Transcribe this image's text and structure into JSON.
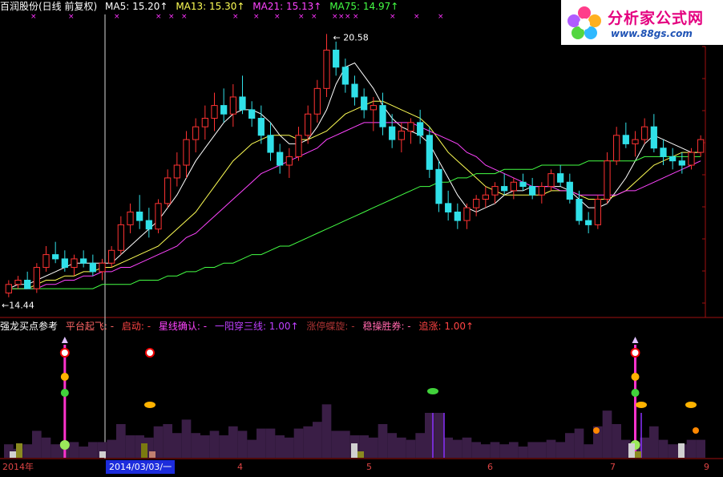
{
  "header": {
    "stock": "百润股份(日线 前复权)",
    "ma_items": [
      {
        "label": "MA5: 15.20↑",
        "color": "#ffffff"
      },
      {
        "label": "MA13: 15.30↑",
        "color": "#ffff55"
      },
      {
        "label": "MA21: 15.13↑",
        "color": "#ff44ff"
      },
      {
        "label": "MA75: 14.97↑",
        "color": "#44ff44"
      }
    ]
  },
  "logo": {
    "title": "分析家公式网",
    "url": "www.88gs.com"
  },
  "main_chart": {
    "type": "candlestick",
    "high_label": "20.58",
    "low_label": "14.44",
    "ylim": [
      14.0,
      21.0
    ],
    "up_color": "#ff3232",
    "down_color": "#30e0e8",
    "candles": [
      [
        14.5,
        14.8,
        14.4,
        14.7
      ],
      [
        14.7,
        14.9,
        14.6,
        14.8
      ],
      [
        14.8,
        15.0,
        14.6,
        14.6
      ],
      [
        14.6,
        15.2,
        14.5,
        15.1
      ],
      [
        15.1,
        15.6,
        15.0,
        15.4
      ],
      [
        15.4,
        15.7,
        15.2,
        15.3
      ],
      [
        15.3,
        15.5,
        15.0,
        15.1
      ],
      [
        15.1,
        15.4,
        14.9,
        15.3
      ],
      [
        15.3,
        15.5,
        15.1,
        15.2
      ],
      [
        15.2,
        15.4,
        14.9,
        15.0
      ],
      [
        15.0,
        15.3,
        14.8,
        15.2
      ],
      [
        15.2,
        15.6,
        15.1,
        15.5
      ],
      [
        15.5,
        16.3,
        15.4,
        16.1
      ],
      [
        16.1,
        16.6,
        15.9,
        16.4
      ],
      [
        16.4,
        16.8,
        16.0,
        16.2
      ],
      [
        16.2,
        16.5,
        15.8,
        16.0
      ],
      [
        16.0,
        16.7,
        15.9,
        16.6
      ],
      [
        16.6,
        17.4,
        16.5,
        17.2
      ],
      [
        17.2,
        17.8,
        17.0,
        17.5
      ],
      [
        17.5,
        18.3,
        17.2,
        18.1
      ],
      [
        18.1,
        18.6,
        17.8,
        18.4
      ],
      [
        18.4,
        18.9,
        18.1,
        18.6
      ],
      [
        18.6,
        19.2,
        18.3,
        18.9
      ],
      [
        18.9,
        19.3,
        18.5,
        18.7
      ],
      [
        18.7,
        19.4,
        18.4,
        19.1
      ],
      [
        19.1,
        19.6,
        18.7,
        18.8
      ],
      [
        18.8,
        19.0,
        18.4,
        18.6
      ],
      [
        18.6,
        18.9,
        18.0,
        18.2
      ],
      [
        18.2,
        18.5,
        17.6,
        17.8
      ],
      [
        17.8,
        18.0,
        17.3,
        17.5
      ],
      [
        17.5,
        17.9,
        17.2,
        17.7
      ],
      [
        17.7,
        18.4,
        17.6,
        18.2
      ],
      [
        18.2,
        18.9,
        18.0,
        18.7
      ],
      [
        18.7,
        19.5,
        18.5,
        19.3
      ],
      [
        19.3,
        20.58,
        19.1,
        20.2
      ],
      [
        20.2,
        20.4,
        19.6,
        19.8
      ],
      [
        19.8,
        20.0,
        19.2,
        19.4
      ],
      [
        19.4,
        19.6,
        18.9,
        19.1
      ],
      [
        19.1,
        19.3,
        18.6,
        18.8
      ],
      [
        18.8,
        19.1,
        18.3,
        18.9
      ],
      [
        18.9,
        19.2,
        18.2,
        18.4
      ],
      [
        18.4,
        18.7,
        17.9,
        18.1
      ],
      [
        18.1,
        18.5,
        17.8,
        18.3
      ],
      [
        18.3,
        18.6,
        18.0,
        18.5
      ],
      [
        18.5,
        18.8,
        18.0,
        18.2
      ],
      [
        18.2,
        18.4,
        17.2,
        17.4
      ],
      [
        17.4,
        17.6,
        16.4,
        16.6
      ],
      [
        16.6,
        16.9,
        16.2,
        16.4
      ],
      [
        16.4,
        16.6,
        16.0,
        16.2
      ],
      [
        16.2,
        16.6,
        16.0,
        16.5
      ],
      [
        16.5,
        16.8,
        16.3,
        16.7
      ],
      [
        16.7,
        17.0,
        16.5,
        16.8
      ],
      [
        16.8,
        17.1,
        16.6,
        17.0
      ],
      [
        17.0,
        17.3,
        16.8,
        16.9
      ],
      [
        16.9,
        17.2,
        16.7,
        17.1
      ],
      [
        17.1,
        17.3,
        16.9,
        17.0
      ],
      [
        17.0,
        17.2,
        16.7,
        16.8
      ],
      [
        16.8,
        17.1,
        16.6,
        17.0
      ],
      [
        17.0,
        17.4,
        16.9,
        17.3
      ],
      [
        17.3,
        17.5,
        17.0,
        17.1
      ],
      [
        17.1,
        17.3,
        16.6,
        16.7
      ],
      [
        16.7,
        16.9,
        16.1,
        16.2
      ],
      [
        16.2,
        16.4,
        15.9,
        16.1
      ],
      [
        16.1,
        16.8,
        16.0,
        16.7
      ],
      [
        16.7,
        17.8,
        16.6,
        17.6
      ],
      [
        17.6,
        18.4,
        17.5,
        18.2
      ],
      [
        18.2,
        18.5,
        17.9,
        18.0
      ],
      [
        18.0,
        18.3,
        17.7,
        18.1
      ],
      [
        18.1,
        18.6,
        18.0,
        18.4
      ],
      [
        18.4,
        18.7,
        17.8,
        17.9
      ],
      [
        17.9,
        18.1,
        17.5,
        17.7
      ],
      [
        17.7,
        17.9,
        17.4,
        17.6
      ],
      [
        17.6,
        17.8,
        17.3,
        17.5
      ],
      [
        17.5,
        17.9,
        17.4,
        17.8
      ],
      [
        17.8,
        18.2,
        17.7,
        18.1
      ]
    ],
    "ma_lines": [
      {
        "name": "MA5",
        "color": "#ffffff",
        "values": [
          14.6,
          14.7,
          14.7,
          14.8,
          14.9,
          15.0,
          15.1,
          15.2,
          15.2,
          15.2,
          15.2,
          15.2,
          15.4,
          15.6,
          15.8,
          16.0,
          16.2,
          16.5,
          16.8,
          17.2,
          17.6,
          17.9,
          18.2,
          18.5,
          18.7,
          18.8,
          18.8,
          18.7,
          18.5,
          18.2,
          18.0,
          18.0,
          18.1,
          18.4,
          18.8,
          19.4,
          19.8,
          19.9,
          19.6,
          19.3,
          18.9,
          18.6,
          18.4,
          18.3,
          18.2,
          18.0,
          17.6,
          17.2,
          16.8,
          16.5,
          16.4,
          16.5,
          16.6,
          16.8,
          16.9,
          16.9,
          17.0,
          17.0,
          17.0,
          17.0,
          16.9,
          16.7,
          16.5,
          16.5,
          16.6,
          16.9,
          17.2,
          17.6,
          18.0,
          18.2,
          18.1,
          18.0,
          17.9,
          17.8,
          17.8
        ]
      },
      {
        "name": "MA13",
        "color": "#ffff55",
        "values": [
          14.6,
          14.6,
          14.6,
          14.7,
          14.8,
          14.8,
          14.9,
          14.9,
          15.0,
          15.0,
          15.1,
          15.1,
          15.2,
          15.3,
          15.4,
          15.5,
          15.6,
          15.8,
          16.0,
          16.2,
          16.4,
          16.7,
          17.0,
          17.3,
          17.6,
          17.8,
          18.0,
          18.1,
          18.2,
          18.2,
          18.2,
          18.1,
          18.1,
          18.2,
          18.3,
          18.5,
          18.7,
          18.8,
          18.9,
          19.0,
          19.0,
          18.9,
          18.8,
          18.7,
          18.6,
          18.4,
          18.1,
          17.8,
          17.6,
          17.4,
          17.2,
          17.0,
          16.9,
          16.8,
          16.8,
          16.8,
          16.8,
          16.8,
          16.9,
          16.9,
          16.9,
          16.8,
          16.7,
          16.7,
          16.7,
          16.8,
          16.9,
          17.1,
          17.3,
          17.5,
          17.6,
          17.7,
          17.8,
          17.8,
          17.8
        ]
      },
      {
        "name": "MA21",
        "color": "#ff44ff",
        "values": [
          14.6,
          14.6,
          14.6,
          14.6,
          14.7,
          14.7,
          14.8,
          14.8,
          14.9,
          14.9,
          15.0,
          15.0,
          15.1,
          15.1,
          15.2,
          15.3,
          15.4,
          15.5,
          15.6,
          15.8,
          15.9,
          16.1,
          16.3,
          16.5,
          16.7,
          16.9,
          17.1,
          17.3,
          17.4,
          17.5,
          17.6,
          17.7,
          17.8,
          17.9,
          18.1,
          18.2,
          18.3,
          18.4,
          18.5,
          18.5,
          18.5,
          18.5,
          18.5,
          18.5,
          18.4,
          18.3,
          18.2,
          18.1,
          18.0,
          17.8,
          17.7,
          17.5,
          17.4,
          17.3,
          17.2,
          17.1,
          17.0,
          17.0,
          17.0,
          16.9,
          16.9,
          16.8,
          16.8,
          16.8,
          16.8,
          16.8,
          16.9,
          16.9,
          17.0,
          17.1,
          17.2,
          17.3,
          17.4,
          17.5,
          17.6
        ]
      },
      {
        "name": "MA75",
        "color": "#44ff44",
        "values": [
          14.6,
          14.6,
          14.6,
          14.6,
          14.6,
          14.6,
          14.6,
          14.6,
          14.6,
          14.6,
          14.7,
          14.7,
          14.7,
          14.7,
          14.8,
          14.8,
          14.8,
          14.9,
          14.9,
          15.0,
          15.0,
          15.1,
          15.1,
          15.2,
          15.2,
          15.3,
          15.4,
          15.4,
          15.5,
          15.6,
          15.6,
          15.7,
          15.8,
          15.9,
          16.0,
          16.1,
          16.2,
          16.3,
          16.4,
          16.5,
          16.6,
          16.7,
          16.8,
          16.9,
          17.0,
          17.0,
          17.1,
          17.1,
          17.2,
          17.2,
          17.3,
          17.3,
          17.3,
          17.4,
          17.4,
          17.4,
          17.4,
          17.5,
          17.5,
          17.5,
          17.5,
          17.5,
          17.6,
          17.6,
          17.6,
          17.6,
          17.6,
          17.6,
          17.7,
          17.7,
          17.7,
          17.7,
          17.7,
          17.7,
          17.7
        ]
      }
    ]
  },
  "indicator": {
    "items": [
      {
        "label": "强龙买点参考",
        "color": "#ffffff"
      },
      {
        "label": "平台起飞: -",
        "color": "#ff6666"
      },
      {
        "label": "启动: -",
        "color": "#ff4444"
      },
      {
        "label": "星线确认: -",
        "color": "#ff44ff"
      },
      {
        "label": "一阳穿三线: 1.00↑",
        "color": "#c040ff"
      },
      {
        "label": "涨停蝶旋: -",
        "color": "#aa3333"
      },
      {
        "label": "稳操胜券: -",
        "color": "#ff66aa"
      },
      {
        "label": "追涨: 1.00↑",
        "color": "#ff4444"
      }
    ],
    "signal_bars": [
      6,
      67,
      123,
      127
    ],
    "tiny_purple_bars": [
      90,
      93
    ]
  },
  "xaxis": {
    "labels": [
      {
        "text": "2014年",
        "idx": 0,
        "selected": false
      },
      {
        "text": "2014/03/03/一",
        "idx": 22,
        "selected": true
      },
      {
        "text": "4",
        "idx": 48,
        "selected": false
      },
      {
        "text": "5",
        "idx": 76,
        "selected": false
      },
      {
        "text": "6",
        "idx": 102,
        "selected": false
      },
      {
        "text": "7",
        "idx": 127,
        "selected": false
      },
      {
        "text": "9",
        "idx": 146,
        "selected": false
      }
    ]
  }
}
